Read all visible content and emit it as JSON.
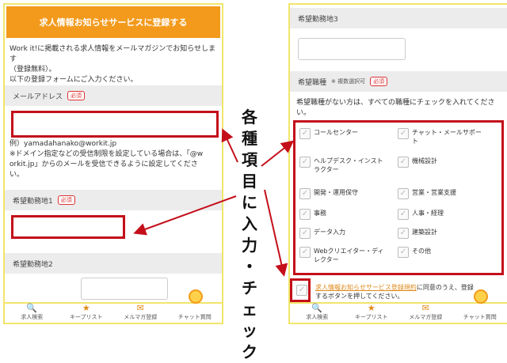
{
  "left": {
    "banner": "求人情報お知らせサービスに登録する",
    "intro_line1": "Work it!に掲載される求人情報をメールマガジンでお知らせします",
    "intro_line2": "（登録無料）。",
    "intro_line3": "以下の登録フォームにご入力ください。",
    "email_label": "メールアドレス",
    "required": "必須",
    "email_example": "例）yamadahanako@workit.jp",
    "email_note1": "※ドメイン指定などの受信制限を設定している場合は、「@w",
    "email_note2": "orkit.jp」からのメールを受信できるように設定してくださ",
    "email_note3": "い。",
    "area1_label": "希望勤務地1",
    "area2_label": "希望勤務地2"
  },
  "right": {
    "area3_label": "希望勤務地3",
    "job_label": "希望職種",
    "job_note": "※ 複数選択可",
    "required": "必須",
    "job_help1": "希望職種がない方は、すべての職種にチェックを入れてくださ",
    "job_help2": "い。",
    "jobs_left": [
      "コールセンター",
      "ヘルプデスク・インスト",
      "ラクター",
      "開発・運用保守",
      "事務",
      "データ入力",
      "Webクリエイター・ディ",
      "レクター"
    ],
    "jobs_right": [
      "チャット・メールサポー",
      "ト",
      "機械設計",
      "営業・営業支援",
      "人事・経理",
      "建築設計",
      "その他"
    ],
    "terms_link": "求人情報お知らせサービス登録規約",
    "terms_text1": "に同意のうえ、登録",
    "terms_text2": "するボタンを押してください。"
  },
  "tabs": [
    {
      "label": "求人検索",
      "icon": "search-icon"
    },
    {
      "label": "キープリスト",
      "icon": "star-icon"
    },
    {
      "label": "メルマガ登録",
      "icon": "mail-icon"
    },
    {
      "label": "チャット質問",
      "icon": "chat-character-icon"
    }
  ],
  "annotation": [
    "各",
    "種",
    "項",
    "目",
    "に",
    "入",
    "力",
    "・",
    "チ",
    "ェ",
    "ッ",
    "ク"
  ],
  "colors": {
    "accent": "#f39a1c",
    "highlight": "#c40f1a",
    "frame": "#f2e56a"
  }
}
